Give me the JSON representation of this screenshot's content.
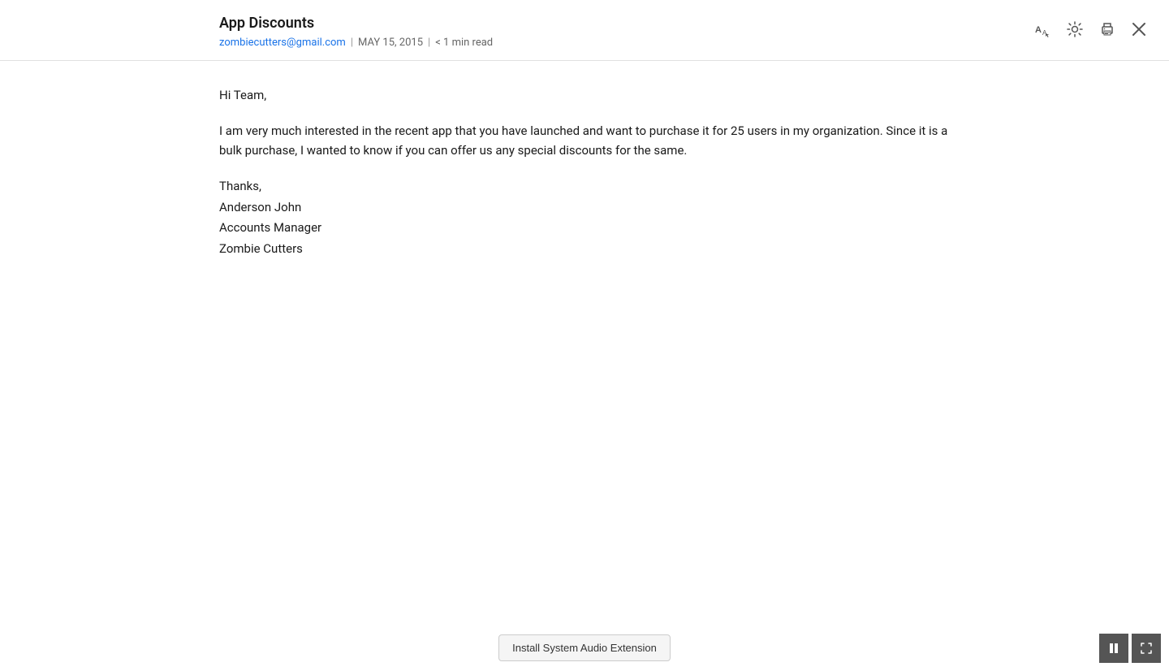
{
  "header": {
    "subject": "App Discounts",
    "sender_email": "zombiecutters@gmail.com",
    "date": "MAY 15, 2015",
    "read_time": "< 1 min read",
    "separator": "|"
  },
  "body": {
    "greeting": "Hi Team,",
    "paragraph1": "I am very much interested in the recent app that you have launched and want to purchase it for 25 users in my organization. Since it is a bulk purchase, I wanted to know if you can offer us any special discounts for the same.",
    "thanks": "Thanks,",
    "name": "Anderson John",
    "title": "Accounts Manager",
    "company": "Zombie Cutters"
  },
  "bottom_bar": {
    "install_btn_label": "Install System Audio Extension"
  },
  "actions": {
    "text_size_tooltip": "Text Size",
    "brightness_tooltip": "Brightness",
    "print_tooltip": "Print",
    "close_tooltip": "Close"
  },
  "controls": {
    "pause_label": "Pause",
    "fullscreen_label": "Fullscreen"
  }
}
